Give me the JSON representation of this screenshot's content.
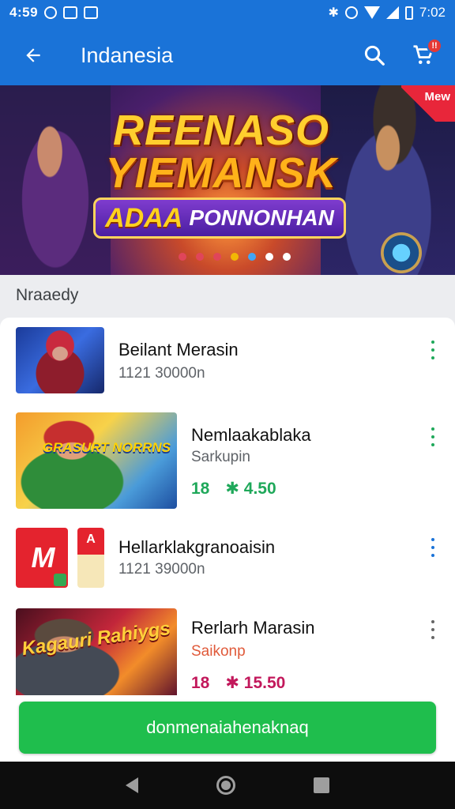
{
  "status_bar": {
    "left_time": "4:59",
    "clock": "7:02",
    "icons": [
      "notification-icon",
      "mail-icon",
      "image-icon",
      "bluetooth-icon",
      "alarm-icon",
      "wifi-icon",
      "signal-icon",
      "battery-icon"
    ]
  },
  "app_bar": {
    "title": "Indanesia",
    "cart_badge": "!!"
  },
  "banner": {
    "title_line1": "REENASO",
    "title_line2": "YIEMANSK",
    "subtitle_a": "ADAA",
    "subtitle_b": "PONNONHAN",
    "corner_label": "Mew",
    "dot_colors": [
      "#e0455a",
      "#e0455a",
      "#e0455a",
      "#f2b705",
      "#42a5f5",
      "#ffffff",
      "#ffffff"
    ]
  },
  "section": {
    "title": "Nraaedy"
  },
  "list": [
    {
      "title": "Beilant Merasin",
      "subtitle": "1121 30000n",
      "price_a": "",
      "price_b": "",
      "kebab_color": "#1fa85a"
    },
    {
      "title": "Nemlaakablaka",
      "subtitle": "Sarkupin",
      "price_a": "18",
      "price_b": "✱ 4.50",
      "kebab_color": "#1fa85a",
      "thumb_text": "GRASURT NORRNS"
    },
    {
      "title": "Hellarklakgranoaisin",
      "subtitle": "1121 39000n",
      "price_a": "",
      "price_b": "",
      "kebab_color": "#1a73d8",
      "thumb_logo": "M",
      "thumb_logo_b": "A"
    },
    {
      "title": "Rerlarh Marasin",
      "subtitle": "Saikonp",
      "price_a": "18",
      "price_b": "✱ 15.50",
      "kebab_color": "#666666",
      "thumb_text": "Kagauri Rahiygs"
    }
  ],
  "action": {
    "label": "donmenaiahenaknaq"
  },
  "colors": {
    "primary": "#1a73d8",
    "accent_green": "#1fbe4d",
    "price_green": "#1fa85a",
    "price_pink": "#c2185b"
  }
}
